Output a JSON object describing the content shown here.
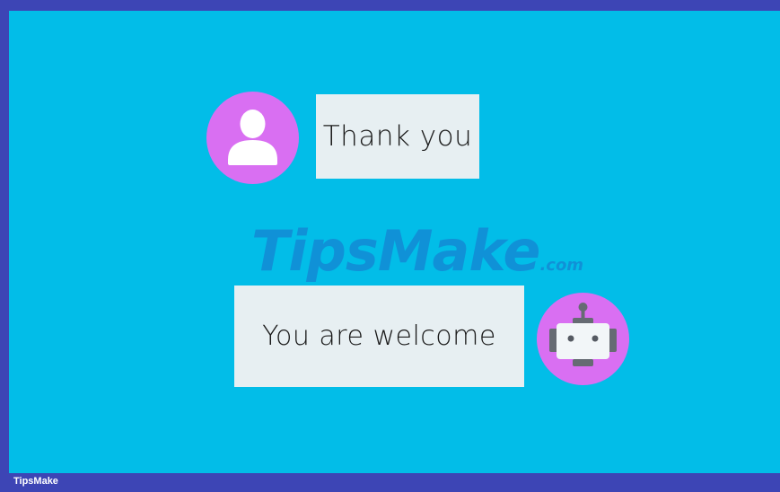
{
  "conversation": {
    "user_message": "Thank you",
    "bot_message": "You are welcome"
  },
  "watermark": {
    "brand": "TipsMake",
    "suffix": ".com"
  },
  "footer": {
    "label": "TipsMake"
  },
  "icons": {
    "user_avatar": "user-icon",
    "bot_avatar": "robot-icon"
  },
  "colors": {
    "background": "#02bde8",
    "frame": "#3d45b5",
    "avatar": "#d96ff2",
    "bubble": "#e7eff2"
  }
}
